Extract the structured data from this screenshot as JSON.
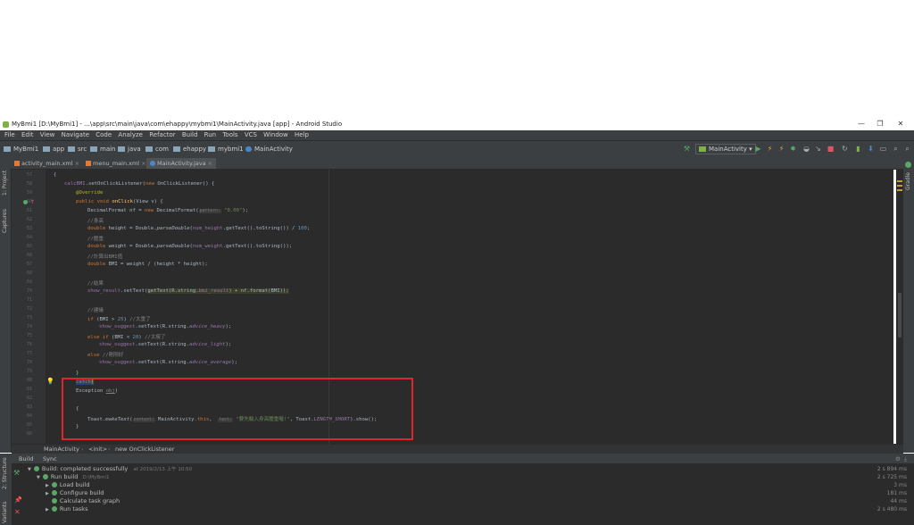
{
  "window": {
    "title": "MyBmi1 [D:\\MyBmi1] - ...\\app\\src\\main\\java\\com\\ehappy\\mybmi1\\MainActivity.java [app] - Android Studio",
    "controls": [
      "—",
      "❐",
      "✕"
    ]
  },
  "menu": [
    "File",
    "Edit",
    "View",
    "Navigate",
    "Code",
    "Analyze",
    "Refactor",
    "Build",
    "Run",
    "Tools",
    "VCS",
    "Window",
    "Help"
  ],
  "breadcrumbs": [
    "MyBmi1",
    "app",
    "src",
    "main",
    "java",
    "com",
    "ehappy",
    "mybmi1",
    "MainActivity"
  ],
  "run_config": "MainActivity",
  "tabs": [
    {
      "label": "activity_main.xml",
      "active": false
    },
    {
      "label": "menu_main.xml",
      "active": false
    },
    {
      "label": "MainActivity.java",
      "active": true
    }
  ],
  "left_tools": [
    "1: Project",
    "Captures"
  ],
  "right_tools": [
    "Gradle"
  ],
  "gutter_lines": [
    "57",
    "58",
    "59",
    "60",
    "61",
    "62",
    "63",
    "64",
    "65",
    "66",
    "67",
    "68",
    "69",
    "70",
    "71",
    "72",
    "73",
    "74",
    "75",
    "76",
    "77",
    "78",
    "79",
    "80",
    "81",
    "82",
    "83",
    "84",
    "85",
    "86",
    "87",
    "88",
    "89",
    "90",
    "91",
    "92",
    "93",
    "94",
    "95",
    "96"
  ],
  "code": {
    "l1": "{",
    "l2_a": "calcBMI",
    "l2_b": ".setOnClickListener(",
    "l2_c": "new",
    "l2_d": " OnClickListener() {",
    "l3": "@Override",
    "l4_a": "public void",
    "l4_b": "onClick",
    "l4_c": "(View v) {",
    "l5_a": "DecimalFormat nf = ",
    "l5_b": "new",
    "l5_c": " DecimalFormat(",
    "l5_hint": "pattern:",
    "l5_str": "\"0.00\"",
    "l5_d": ");",
    "l6": "//身高",
    "l7_a": "double",
    "l7_b": " height = Double.",
    "l7_c": "parseDouble",
    "l7_d": "(",
    "l7_e": "num_height",
    "l7_f": ".getText().toString()) / ",
    "l7_g": "100",
    "l7_h": ";",
    "l8": "//體重",
    "l9_a": "double",
    "l9_b": " weight = Double.",
    "l9_c": "parseDouble",
    "l9_d": "(",
    "l9_e": "num_weight",
    "l9_f": ".getText().toString());",
    "l10": "//計算出BMI值",
    "l11_a": "double",
    "l11_b": " BMI = weight / (height * height);",
    "l12": "//結果",
    "l13_a": "show_result",
    "l13_b": ".setText(",
    "l13_c": "getText(R.string.",
    "l13_d": "bmi_result",
    "l13_e": ") + nf.format(BMI));",
    "l14": "//建議",
    "l15_a": "if",
    "l15_b": " (BMI > ",
    "l15_c": "25",
    "l15_d": ") ",
    "l15_e": "//太重了",
    "l16_a": "show_suggest",
    "l16_b": ".setText(R.string.",
    "l16_c": "advice_heavy",
    "l16_d": ");",
    "l17_a": "else if",
    "l17_b": " (BMI < ",
    "l17_c": "20",
    "l17_d": ") ",
    "l17_e": "//太瘦了",
    "l18_a": "show_suggest",
    "l18_b": ".setText(R.string.",
    "l18_c": "advice_light",
    "l18_d": ");",
    "l19_a": "else",
    "l19_b": " //剛剛好",
    "l20_a": "show_suggest",
    "l20_b": ".setText(R.string.",
    "l20_c": "advice_average",
    "l20_d": ");",
    "l21": "}",
    "l22_a": "catch",
    "l22_b": "(",
    "l23_a": "Exception ",
    "l23_b": "obj",
    "l23_c": ")",
    "l24": "{",
    "l25_a": "Toast.",
    "l25_b": "makeText",
    "l25_c": "(",
    "l25_hint1": "context:",
    "l25_d": " MainActivity.",
    "l25_e": "this",
    "l25_f": ",  ",
    "l25_hint2": "text:",
    "l25_str": "\"要先輸入身高體重喔!\"",
    "l25_g": ", Toast.",
    "l25_h": "LENGTH_SHORT",
    "l25_i": ").show();",
    "l26": "}"
  },
  "code_breadcrumb": [
    "MainActivity",
    "<init>",
    "new OnClickListener"
  ],
  "build_tabs": [
    "Build",
    "Sync"
  ],
  "build_tree": [
    {
      "label": "Build: completed successfully",
      "detail": "at 2019/2/13 上午 10:50",
      "time": "2 s 894 ms"
    },
    {
      "label": "Run build",
      "detail": "D:\\MyBmi1",
      "time": "2 s 725 ms"
    },
    {
      "label": "Load build",
      "detail": "",
      "time": "3 ms"
    },
    {
      "label": "Configure build",
      "detail": "",
      "time": "181 ms"
    },
    {
      "label": "Calculate task graph",
      "detail": "",
      "time": "44 ms"
    },
    {
      "label": "Run tasks",
      "detail": "",
      "time": "2 s 480 ms"
    }
  ],
  "bottom_tools": [
    "2: Structure",
    "Variants"
  ],
  "colors": {
    "accent_red": "#e0262d",
    "run_green": "#59a869",
    "editor_bg": "#2b2b2b",
    "chrome_bg": "#3c3f41"
  }
}
